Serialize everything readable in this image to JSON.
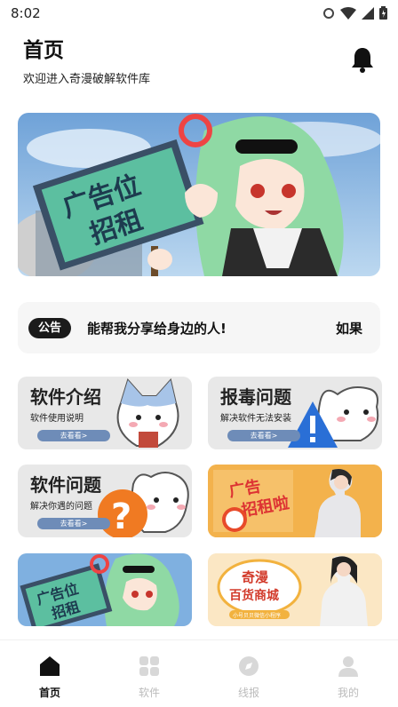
{
  "status_bar": {
    "time": "8:02"
  },
  "header": {
    "title": "首页",
    "subtitle": "欢迎进入奇漫破解软件库"
  },
  "banner": {
    "sign_line1": "广告位",
    "sign_line2": "招租"
  },
  "notice": {
    "badge": "公告",
    "text": "能帮我分享给身边的人!",
    "text_next": "如果"
  },
  "cards": [
    {
      "title": "软件介绍",
      "subtitle": "软件使用说明",
      "button": "去看看>"
    },
    {
      "title": "报毒问题",
      "subtitle": "解决软件无法安装",
      "button": "去看看>"
    },
    {
      "title": "软件问题",
      "subtitle": "解决你遇的问题",
      "button": "去看看>"
    },
    {
      "title": "广告招租啦"
    },
    {
      "sign_line1": "广告位",
      "sign_line2": "招租"
    },
    {
      "line1": "奇漫",
      "line2": "百货商城",
      "line3": "小号贝贝微信小程序"
    }
  ],
  "bottom_nav": [
    {
      "label": "首页",
      "icon": "home-icon",
      "active": true
    },
    {
      "label": "软件",
      "icon": "apps-grid-icon",
      "active": false
    },
    {
      "label": "线报",
      "icon": "compass-icon",
      "active": false
    },
    {
      "label": "我的",
      "icon": "profile-icon",
      "active": false
    }
  ],
  "colors": {
    "accent": "#111111",
    "inactive": "#bbbbbb",
    "card_bg": "#e8e8e8",
    "button": "#6e8cb8"
  }
}
